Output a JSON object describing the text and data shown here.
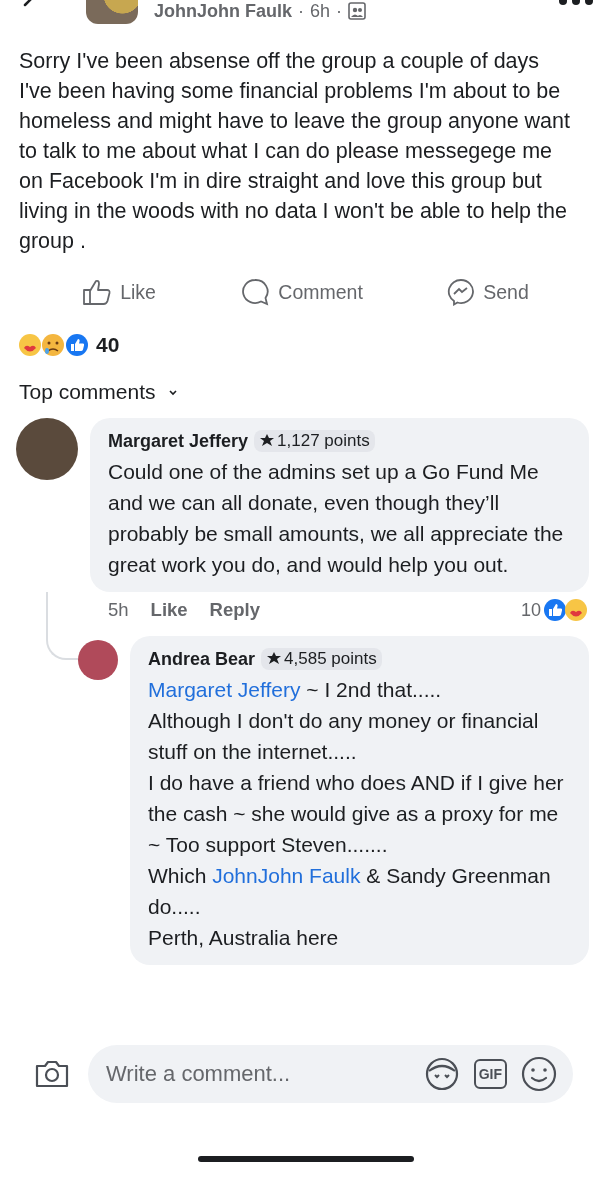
{
  "post": {
    "author": "JohnJohn Faulk",
    "time": "6h",
    "separator": "·",
    "text": "Sorry I've been absense off the group a couple of days I've been having some financial problems I'm about to be homeless and might have to leave the group anyone want to talk to me about what I can do please messegege me on Facebook I'm in dire straight and love this group but living in the woods with no data I won't be able to help the group .",
    "actions": [
      {
        "kind": "like",
        "label": "Like"
      },
      {
        "kind": "comment",
        "label": "Comment"
      },
      {
        "kind": "send",
        "label": "Send"
      }
    ],
    "reaction_count": "40"
  },
  "sort": {
    "label": "Top comments"
  },
  "comments": [
    {
      "author": "Margaret Jeffery",
      "points": "1,127 points",
      "paragraphs": [
        [
          {
            "kind": "text",
            "text": "Could one of the admins set up a Go Fund Me and we can all donate, even though they’ll probably be small amounts, we all appreciate the great work you do, and would help you out."
          }
        ]
      ],
      "time": "5h",
      "like": "Like",
      "reply": "Reply",
      "reaction_count": "10",
      "replies": [
        {
          "author": "Andrea Bear",
          "points": "4,585 points",
          "paragraphs": [
            [
              {
                "kind": "link",
                "text": "Margaret Jeffery"
              },
              {
                "kind": "text",
                "text": " ~ I 2nd that....."
              }
            ],
            [
              {
                "kind": "text",
                "text": "Although I don't do any money or financial stuff on the internet....."
              }
            ],
            [
              {
                "kind": "text",
                "text": "I do have a friend who does AND if I give her the cash ~ she would give as a proxy for me ~ Too support Steven......."
              }
            ],
            [
              {
                "kind": "text",
                "text": "Which "
              },
              {
                "kind": "link",
                "text": "JohnJohn Faulk"
              },
              {
                "kind": "text",
                "text": " & Sandy Greenman do....."
              }
            ],
            [
              {
                "kind": "text",
                "text": "Perth, Australia here"
              }
            ]
          ]
        }
      ]
    }
  ],
  "composer": {
    "placeholder": "Write a comment...",
    "gif": "GIF"
  }
}
